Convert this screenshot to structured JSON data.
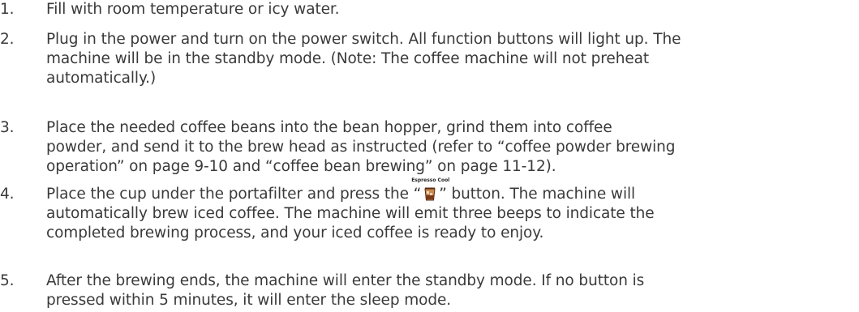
{
  "steps": [
    {
      "number": "1.",
      "lines": [
        "Fill with room temperature or icy water."
      ]
    },
    {
      "number": "2.",
      "lines": [
        "Plug in the power and turn on the power switch. All function buttons will light up. The",
        "machine will be in the standby mode. (Note: The coffee machine will not preheat",
        "automatically.)"
      ]
    },
    {
      "number": "3.",
      "lines": [
        "Place the needed coffee beans into the bean hopper, grind them into coffee",
        "powder, and send it to the brew head as instructed (refer to “coffee powder brewing",
        "operation” on page 9-10 and “coffee bean brewing” on page 11-12)."
      ]
    },
    {
      "number": "4.",
      "line1_before": "Place the cup under the portafilter and press the “",
      "line1_after": "” button. The machine will",
      "icon_label": "Espresso Cool",
      "icon_name": "iced-coffee-cup-icon",
      "lines_rest": [
        "automatically brew iced coffee. The machine will emit three beeps to indicate the",
        "completed brewing process, and your iced coffee is ready to enjoy."
      ]
    },
    {
      "number": "5.",
      "lines": [
        "After the brewing ends, the machine will enter the standby mode. If no button is",
        "pressed within 5 minutes, it will enter the sleep mode."
      ]
    }
  ],
  "colors": {
    "text": "#3a3a3a",
    "icon_dark": "#5a2a14",
    "icon_light": "#c98a4b"
  }
}
